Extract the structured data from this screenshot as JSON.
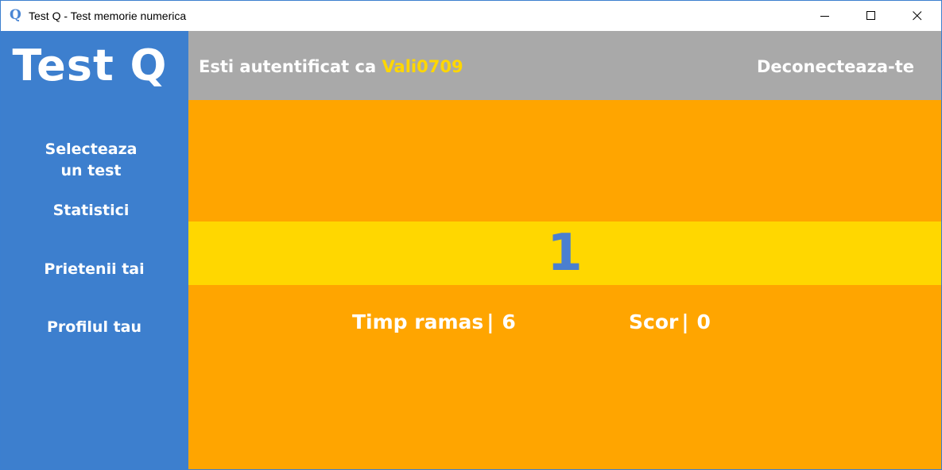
{
  "window": {
    "title": "Test Q - Test memorie numerica",
    "icon_glyph": "Q",
    "controls": [
      "minimize-icon",
      "maximize-icon",
      "close-icon"
    ]
  },
  "sidebar": {
    "logo": "Test Q",
    "items": [
      {
        "label_line1": "Selecteaza",
        "label_line2": "un test"
      },
      {
        "label": "Statistici"
      },
      {
        "label": "Prietenii tai"
      },
      {
        "label": "Profilul tau"
      }
    ]
  },
  "header": {
    "auth_prefix": "Esti autentificat ca",
    "username": "Vali0709",
    "logout_label": "Deconecteaza-te"
  },
  "game": {
    "current_number": "1",
    "time_label": "Timp ramas",
    "time_value": "6",
    "score_label": "Scor",
    "score_value": "0",
    "separator": "|"
  },
  "colors": {
    "sidebar": "#3d7fce",
    "header": "#a9a9a9",
    "main": "#ffa500",
    "number_band": "#ffd700",
    "number": "#4a7fd0",
    "username": "#ffd700"
  }
}
